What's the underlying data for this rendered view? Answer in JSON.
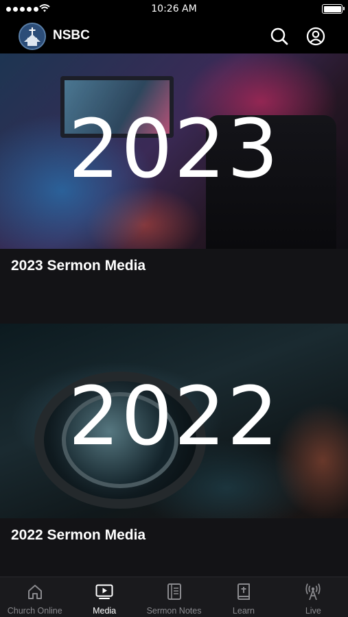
{
  "status_bar": {
    "time": "10:26 AM"
  },
  "header": {
    "app_name": "NSBC",
    "icons": [
      "search-icon",
      "account-icon"
    ]
  },
  "media_items": [
    {
      "overlay_year": "2023",
      "title": "2023 Sermon Media"
    },
    {
      "overlay_year": "2022",
      "title": "2022 Sermon Media"
    }
  ],
  "tab_bar": {
    "active": "Media",
    "tabs": [
      {
        "label": "Church Online",
        "icon": "home-icon"
      },
      {
        "label": "Media",
        "icon": "play-screen-icon"
      },
      {
        "label": "Sermon Notes",
        "icon": "notes-icon"
      },
      {
        "label": "Learn",
        "icon": "bible-icon"
      },
      {
        "label": "Live",
        "icon": "broadcast-icon"
      }
    ]
  },
  "colors": {
    "background": "#000000",
    "card": "#131316",
    "tab_bar": "#1a1a1d",
    "inactive_tab": "#8a8a8e",
    "active_tab": "#ffffff"
  }
}
